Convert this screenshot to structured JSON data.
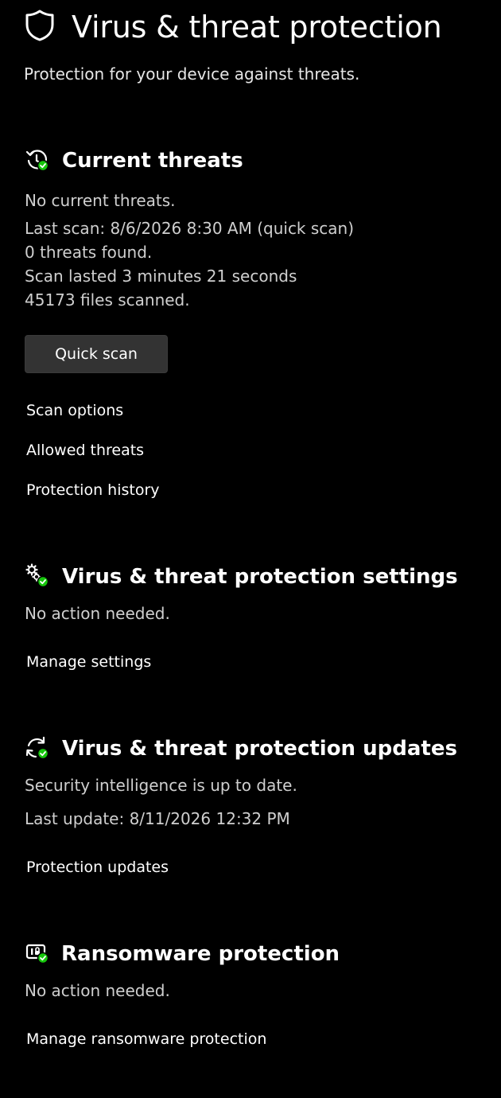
{
  "header": {
    "title": "Virus & threat protection",
    "subtitle": "Protection for your device against threats.",
    "icon": "shield-icon"
  },
  "current_threats": {
    "title": "Current threats",
    "icon": "history-check-icon",
    "status": "No current threats.",
    "last_scan": "Last scan: 8/6/2026 8:30 AM (quick scan)",
    "threats_found": "0 threats found.",
    "scan_duration": "Scan lasted 3 minutes 21 seconds",
    "files_scanned": "45173 files scanned.",
    "quick_scan_label": "Quick scan",
    "links": [
      "Scan options",
      "Allowed threats",
      "Protection history"
    ]
  },
  "settings": {
    "title": "Virus & threat protection settings",
    "icon": "gears-check-icon",
    "status": "No action needed.",
    "link": "Manage settings"
  },
  "updates": {
    "title": "Virus & threat protection updates",
    "icon": "refresh-check-icon",
    "status": "Security intelligence is up to date.",
    "last_update": "Last update: 8/11/2026 12:32 PM",
    "link": "Protection updates"
  },
  "ransomware": {
    "title": "Ransomware protection",
    "icon": "ransomware-check-icon",
    "status": "No action needed.",
    "link": "Manage ransomware protection"
  },
  "colors": {
    "background": "#000000",
    "button_bg": "#333333",
    "check_green": "#16c60c"
  }
}
